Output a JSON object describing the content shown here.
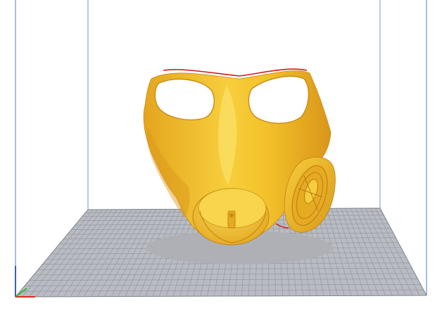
{
  "viewport": {
    "kind": "slicer-3d-preview",
    "background_color": "#ffffff",
    "build_volume_edge_color": "#8aa9d6",
    "build_plate_color": "#b9bcc3",
    "build_plate_grid_color": "#8e9299"
  },
  "model": {
    "name": "gas-mask",
    "color": "#f2c027",
    "shadow_color": "#aeb0b5",
    "overhang_edge_color": "#d21b1b"
  },
  "axes": {
    "x_color": "#e0281e",
    "y_color": "#2fb830",
    "z_color": "#3a5bd8"
  }
}
